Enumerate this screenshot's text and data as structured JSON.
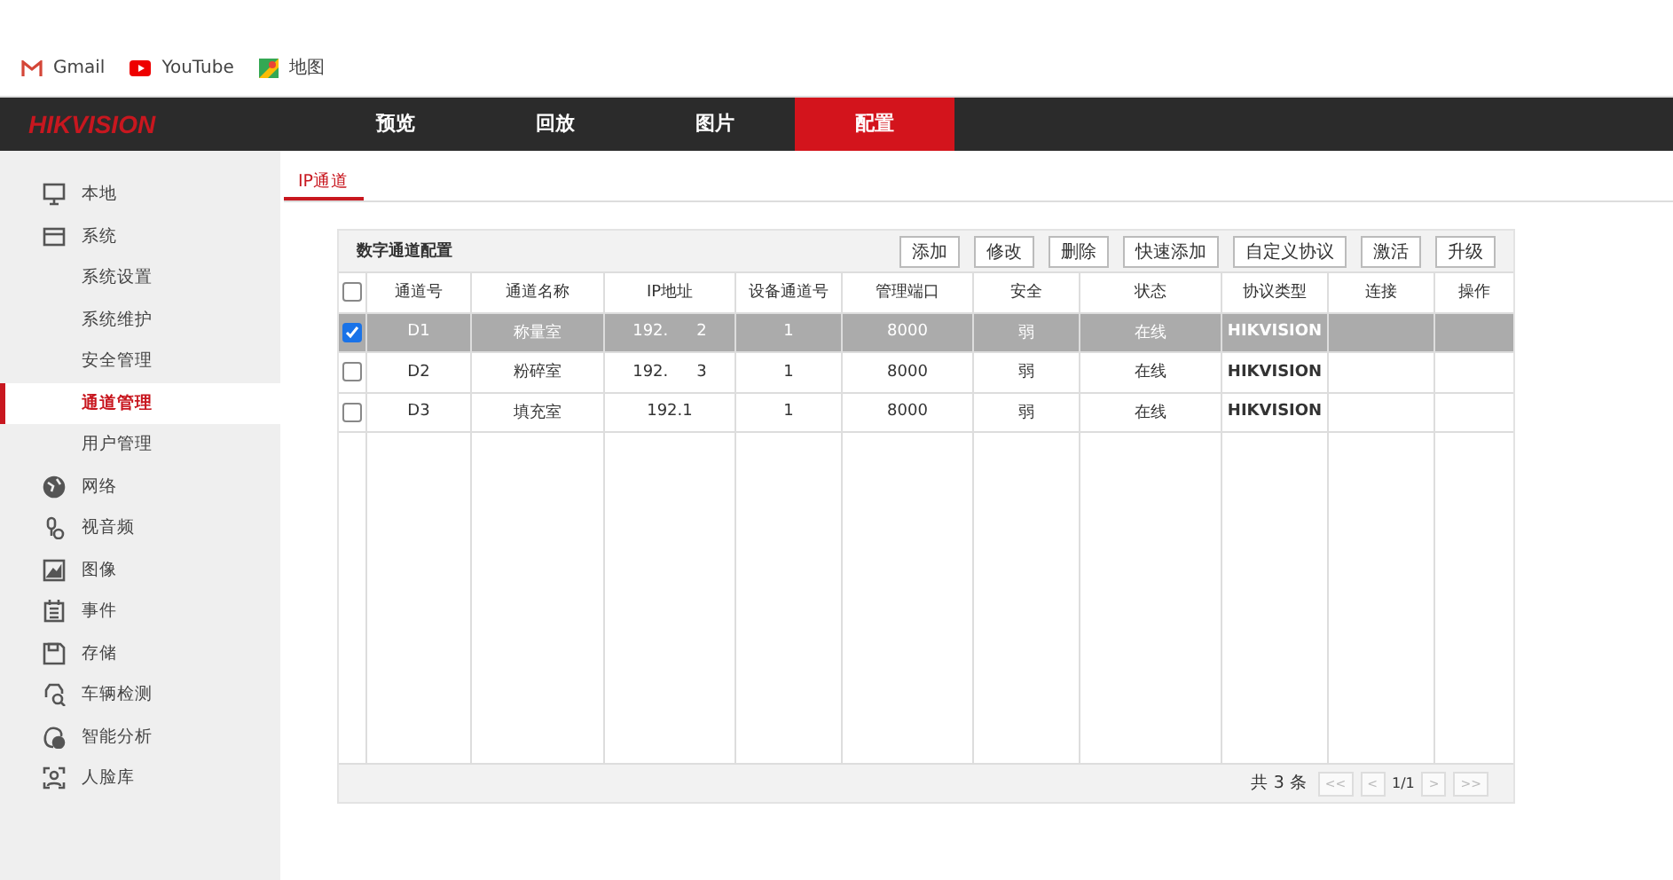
{
  "bookmarks": [
    {
      "kind": "gmail",
      "label": "Gmail"
    },
    {
      "kind": "youtube",
      "label": "YouTube"
    },
    {
      "kind": "maps",
      "label": "地图"
    }
  ],
  "header": {
    "logo": "HIKVISION",
    "tabs": [
      {
        "label": "预览",
        "selected": false
      },
      {
        "label": "回放",
        "selected": false
      },
      {
        "label": "图片",
        "selected": false
      },
      {
        "label": "配置",
        "selected": true
      }
    ]
  },
  "sidebar": {
    "items": [
      {
        "label": "本地",
        "selected": false
      },
      {
        "label": "系统",
        "selected": false,
        "children": [
          {
            "label": "系统设置",
            "selected": false
          },
          {
            "label": "系统维护",
            "selected": false
          },
          {
            "label": "安全管理",
            "selected": false
          },
          {
            "label": "通道管理",
            "selected": true
          },
          {
            "label": "用户管理",
            "selected": false
          }
        ]
      },
      {
        "label": "网络",
        "selected": false
      },
      {
        "label": "视音频",
        "selected": false
      },
      {
        "label": "图像",
        "selected": false
      },
      {
        "label": "事件",
        "selected": false
      },
      {
        "label": "存储",
        "selected": false
      },
      {
        "label": "车辆检测",
        "selected": false
      },
      {
        "label": "智能分析",
        "selected": false
      },
      {
        "label": "人脸库",
        "selected": false
      }
    ]
  },
  "subtabs": [
    {
      "label": "IP通道",
      "selected": true
    }
  ],
  "panel": {
    "title": "数字通道配置",
    "buttons": [
      "添加",
      "修改",
      "删除",
      "快速添加",
      "自定义协议",
      "激活",
      "升级"
    ],
    "table": {
      "select_all_checked": false,
      "columns": [
        "通道号",
        "通道名称",
        "IP地址",
        "设备通道号",
        "管理端口",
        "安全",
        "状态",
        "协议类型",
        "连接",
        "操作"
      ],
      "rows": [
        {
          "checked": true,
          "selected": true,
          "cells": [
            "D1",
            "称量室",
            "192.",
            "1",
            "8000",
            "弱",
            "在线",
            "HIKVISION"
          ],
          "ip_tail": "2"
        },
        {
          "checked": false,
          "selected": false,
          "cells": [
            "D2",
            "粉碎室",
            "192.",
            "1",
            "8000",
            "弱",
            "在线",
            "HIKVISION"
          ],
          "ip_tail": "3"
        },
        {
          "checked": false,
          "selected": false,
          "cells": [
            "D3",
            "填充室",
            "192.1",
            "1",
            "8000",
            "弱",
            "在线",
            "HIKVISION"
          ],
          "ip_tail": ""
        }
      ]
    },
    "pager": {
      "total": "共 3 条",
      "first": "<<",
      "prev": "<",
      "page": "1/1",
      "next": ">",
      "last": ">>"
    }
  }
}
